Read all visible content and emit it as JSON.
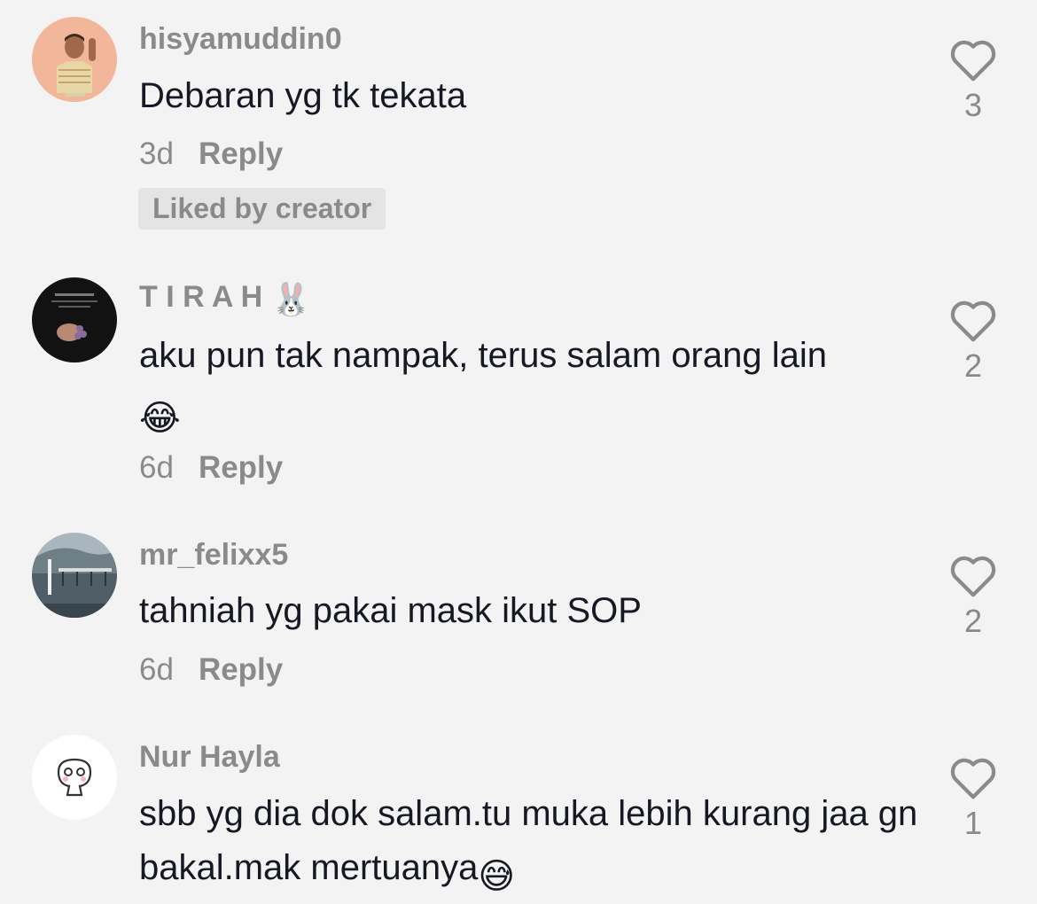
{
  "comments": [
    {
      "username": "hisyamuddin0",
      "text": "Debaran yg tk tekata",
      "time": "3d",
      "reply_label": "Reply",
      "badge": "Liked by creator",
      "likes": "3",
      "avatar": "memoji-avatar"
    },
    {
      "username": "T I R A H",
      "username_emoji": "🐰",
      "text": "aku pun tak nampak, terus salam orang lain",
      "text_emoji": "😂",
      "time": "6d",
      "reply_label": "Reply",
      "likes": "2",
      "avatar": "dark-photo-avatar"
    },
    {
      "username": "mr_felixx5",
      "text": "tahniah yg pakai mask ikut SOP",
      "time": "6d",
      "reply_label": "Reply",
      "likes": "2",
      "avatar": "lake-photo-avatar"
    },
    {
      "username": "Nur Hayla",
      "text": "sbb yg dia dok salam.tu muka lebih kurang jaa gn bakal.mak mertuanya",
      "text_emoji": "😅",
      "likes": "1",
      "avatar": "cartoon-avatar"
    }
  ],
  "icons": {
    "like": "heart-outline-icon"
  },
  "colors": {
    "background": "#f3f3f3",
    "text": "#161823",
    "muted": "#8a8a8a",
    "badge_bg": "#e4e4e4"
  }
}
